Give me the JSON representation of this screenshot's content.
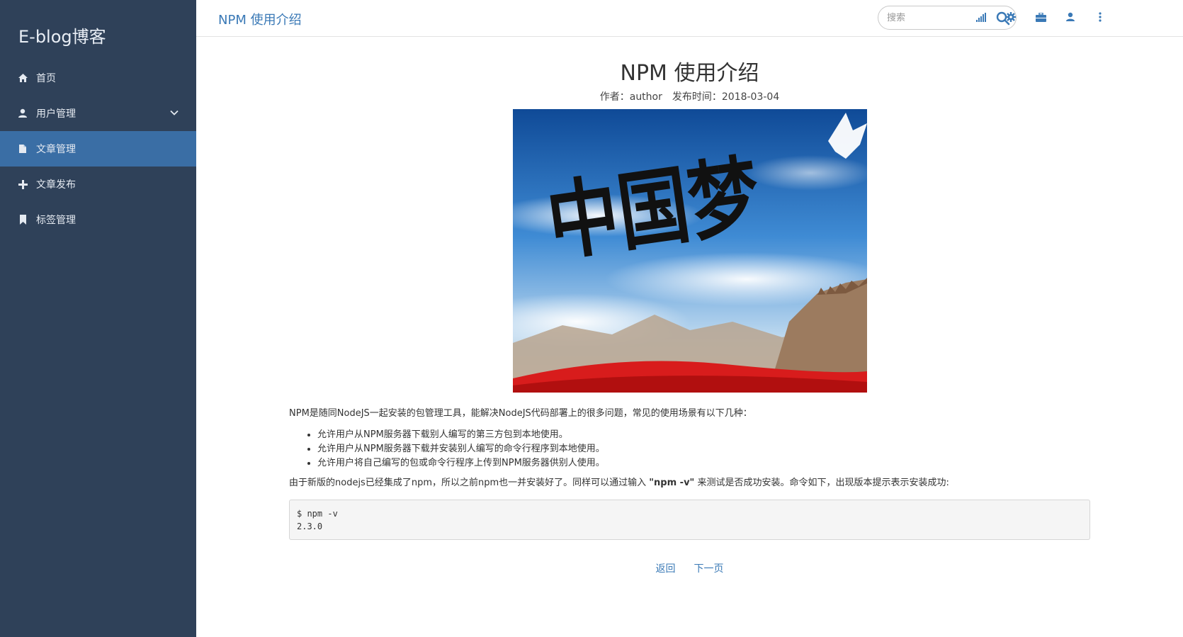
{
  "sidebar": {
    "brand": "E-blog博客",
    "items": [
      {
        "label": "首页",
        "icon": "home-icon"
      },
      {
        "label": "用户管理",
        "icon": "user-icon"
      },
      {
        "label": "文章管理",
        "icon": "file-icon"
      },
      {
        "label": "文章发布",
        "icon": "plus-icon"
      },
      {
        "label": "标签管理",
        "icon": "bookmark-icon"
      }
    ]
  },
  "header": {
    "title": "NPM 使用介绍",
    "search_placeholder": "搜索",
    "toolbar_icons": [
      "signal-icon",
      "gear-icon",
      "briefcase-icon",
      "user-icon",
      "more-vertical-icon"
    ]
  },
  "article": {
    "title": "NPM 使用介绍",
    "author": "作者：author",
    "date": "发布时间：2018-03-04",
    "image_text": "中国梦",
    "intro": "NPM是随同NodeJS一起安装的包管理工具，能解决NodeJS代码部署上的很多问题，常见的使用场景有以下几种：",
    "list": [
      "允许用户从NPM服务器下载别人编写的第三方包到本地使用。",
      "允许用户从NPM服务器下载并安装别人编写的命令行程序到本地使用。",
      "允许用户将自己编写的包或命令行程序上传到NPM服务器供别人使用。"
    ],
    "para2_before": "由于新版的nodejs已经集成了npm，所以之前npm也一并安装好了。同样可以通过输入 ",
    "para2_bold": "\"npm -v\"",
    "para2_after": " 来测试是否成功安装。命令如下，出现版本提示表示安装成功:",
    "code_lines": [
      "$ npm -v",
      "2.3.0"
    ]
  },
  "pager": {
    "back": "返回",
    "next": "下一页"
  },
  "colors": {
    "sidebar_bg": "#2f4159",
    "active": "#3a6ea5",
    "link": "#3a79b6"
  }
}
